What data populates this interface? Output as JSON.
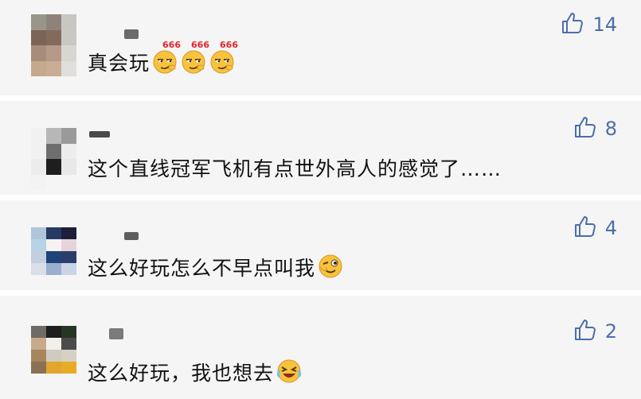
{
  "comments": [
    {
      "text": "真会玩",
      "likes": "14",
      "emoji_after": [
        "smirk-666-emoji",
        "smirk-666-emoji",
        "smirk-666-emoji"
      ],
      "emoji_tag": "666",
      "avatar_colors": [
        "#9a958a",
        "#8d837a",
        "#c9c7c3",
        "#7b6356",
        "#836b5c",
        "#c9c8c4",
        "#a88c7a",
        "#b69a87",
        "#d7d6d2",
        "#c5a98f",
        "#c9ad94",
        "#e0deda"
      ],
      "name_blur_color": "#6b6b6b"
    },
    {
      "text": "这个直线冠军飞机有点世外高人的感觉了……",
      "likes": "8",
      "emoji_after": [],
      "avatar_colors": [
        "#f1f1f1",
        "#b7b7b7",
        "#9a9a9a",
        "#f1f1f1",
        "#6e6e6e",
        "#ededed",
        "#ececec",
        "#1e1e1e",
        "#e8e8e8",
        "#f3f3f3",
        "#f5f5f5",
        "#f5f5f5"
      ],
      "name_blur_color": "#4a4a4a"
    },
    {
      "text": "这么好玩怎么不早点叫我",
      "likes": "4",
      "emoji_after": [
        "wink-emoji"
      ],
      "avatar_colors": [
        "#afc6d9",
        "#263a63",
        "#1e1e3a",
        "#b8d3e6",
        "#f7f1f0",
        "#e7d4da",
        "#c3cfdf",
        "#1f4279",
        "#2b3d6a",
        "#d8dfe9",
        "#9aaed0",
        "#c9d5e6"
      ],
      "name_blur_color": "#5e5e5e"
    },
    {
      "text": "这么好玩，我也想去",
      "likes": "2",
      "emoji_after": [
        "crying-laughing-emoji"
      ],
      "avatar_colors": [
        "#6f6a63",
        "#1e1e1e",
        "#273526",
        "#c8a98a",
        "#f3f0ea",
        "#4b4b4b",
        "#a7865f",
        "#d1cac0",
        "#d7d0c4",
        "#8b7056",
        "#e3a52d",
        "#e7ab27"
      ],
      "name_blur_color": "#7a7a7a"
    }
  ],
  "colors": {
    "background": "#f5f5f5",
    "divider": "#ffffff",
    "like_blue": "#4a6ea9",
    "text": "#111111"
  },
  "icons": {
    "like": "thumbs-up-outline-icon"
  }
}
